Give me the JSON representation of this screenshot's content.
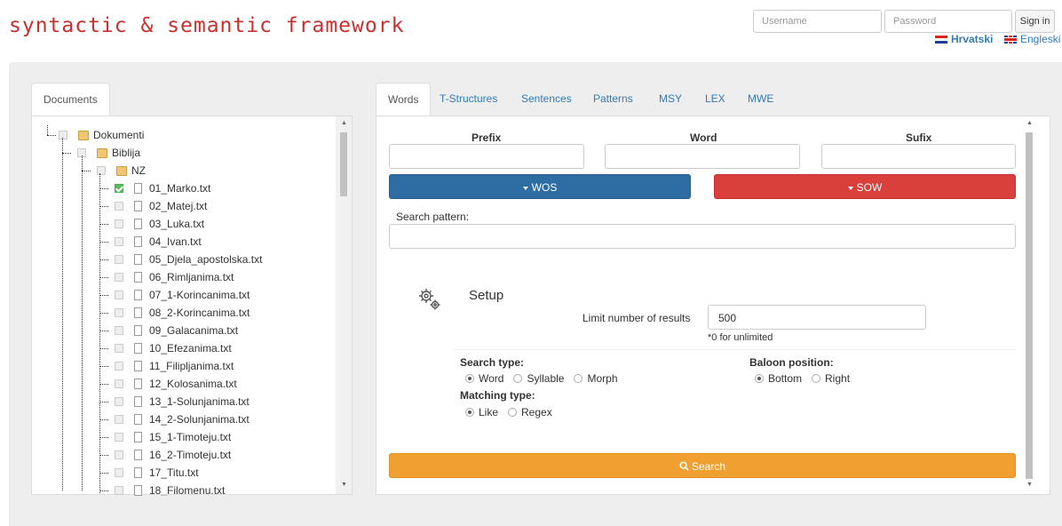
{
  "header": {
    "logo": "Syntactic & Semantic Framework",
    "username_placeholder": "Username",
    "password_placeholder": "Password",
    "signin_label": "Sign in",
    "languages": [
      "Hrvatski",
      "Engleski"
    ]
  },
  "left_panel": {
    "tab": "Documents",
    "tree": {
      "root": "Dokumenti",
      "child": "Biblija",
      "subchild": "NZ",
      "files": [
        "01_Marko.txt",
        "02_Matej.txt",
        "03_Luka.txt",
        "04_Ivan.txt",
        "05_Djela_apostolska.txt",
        "06_Rimljanima.txt",
        "07_1-Korincanima.txt",
        "08_2-Korincanima.txt",
        "09_Galacanima.txt",
        "10_Efezanima.txt",
        "11_Filipljanima.txt",
        "12_Kolosanima.txt",
        "13_1-Solunjanima.txt",
        "14_2-Solunjanima.txt",
        "15_1-Timoteju.txt",
        "16_2-Timoteju.txt",
        "17_Titu.txt",
        "18_Filomenu.txt"
      ],
      "checked_file_index": 0
    }
  },
  "right_panel": {
    "tabs": [
      "Words",
      "T-Structures",
      "Sentences",
      "Patterns",
      "MSY",
      "LEX",
      "MWE"
    ],
    "active_tab": "Words",
    "prefix_label": "Prefix",
    "word_label": "Word",
    "sufix_label": "Sufix",
    "wos_label": "WOS",
    "sow_label": "SOW",
    "search_pattern_label": "Search pattern:",
    "setup": {
      "title": "Setup",
      "limit_label": "Limit number of results",
      "limit_value": "500",
      "limit_hint": "*0 for unlimited",
      "search_type_label": "Search type:",
      "search_type_options": [
        "Word",
        "Syllable",
        "Morph"
      ],
      "search_type_selected": "Word",
      "matching_type_label": "Matching type:",
      "matching_type_options": [
        "Like",
        "Regex"
      ],
      "matching_type_selected": "Like",
      "baloon_label": "Baloon position:",
      "baloon_options": [
        "Bottom",
        "Right"
      ],
      "baloon_selected": "Bottom"
    },
    "search_label": "Search"
  },
  "colors": {
    "logo": "#c9302c",
    "wos": "#2e6da4",
    "sow": "#d9403c",
    "search": "#f0a030",
    "link": "#337ab7"
  }
}
